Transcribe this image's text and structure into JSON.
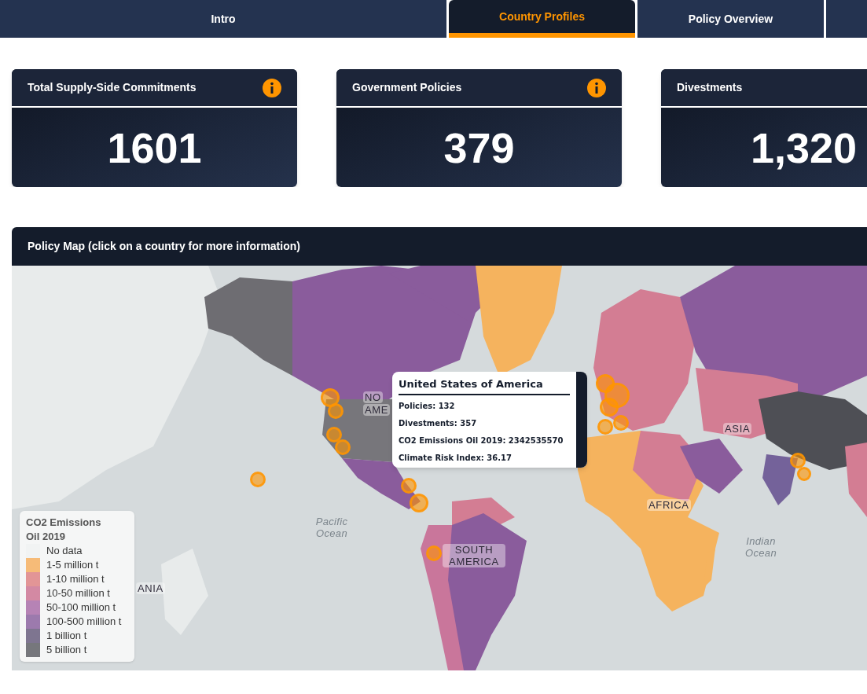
{
  "tabs": [
    {
      "label": "Intro",
      "selected": false
    },
    {
      "label": "Country Profiles",
      "selected": true
    },
    {
      "label": "Policy Overview",
      "selected": false
    },
    {
      "selected": false
    }
  ],
  "stats": [
    {
      "title": "Total Supply-Side Commitments",
      "value": "1601",
      "info": true
    },
    {
      "title": "Government Policies",
      "value": "379",
      "info": true
    },
    {
      "title": "Divestments",
      "value": "1,320"
    }
  ],
  "map": {
    "title": "Policy Map (click on a country for more information)",
    "labels": [
      {
        "text": "NO",
        "kind": "continent"
      },
      {
        "text": "AME",
        "kind": "continent"
      },
      {
        "text": "ASIA",
        "kind": "continent"
      },
      {
        "text": "AFRICA",
        "kind": "continent"
      },
      {
        "text": "SOUTH AMERICA",
        "kind": "continent"
      },
      {
        "text": "ANIA",
        "kind": "continent"
      },
      {
        "text": "Pacific Ocean",
        "kind": "ocean"
      },
      {
        "text": "Indian Ocean",
        "kind": "ocean"
      }
    ],
    "tooltip": {
      "title": "United States of America",
      "lines": [
        "Policies: 132",
        "Divestments: 357",
        "CO2 Emissions Oil 2019: 2342535570",
        "Climate Risk Index: 36.17"
      ]
    },
    "legend": {
      "title": "CO2 Emissions Oil 2019",
      "items": [
        {
          "label": "No data",
          "color": "#f1f3f3"
        },
        {
          "label": "1-5 million t",
          "color": "#f6bb78"
        },
        {
          "label": "1-10 million t",
          "color": "#e29596"
        },
        {
          "label": "10-50 million t",
          "color": "#d389a3"
        },
        {
          "label": "50-100 million t",
          "color": "#b683b5"
        },
        {
          "label": "100-500 million t",
          "color": "#9c7aad"
        },
        {
          "label": "1 billion t",
          "color": "#7e7590"
        },
        {
          "label": "5 billion t",
          "color": "#76777c"
        }
      ]
    }
  }
}
